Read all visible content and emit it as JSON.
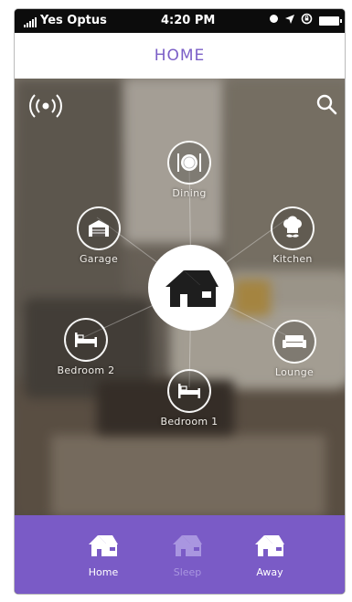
{
  "status_bar": {
    "carrier": "Yes Optus",
    "time": "4:20 PM"
  },
  "header": {
    "title": "HOME"
  },
  "rooms": {
    "dining": "Dining",
    "garage": "Garage",
    "kitchen": "Kitchen",
    "bedroom2": "Bedroom 2",
    "lounge": "Lounge",
    "bedroom1": "Bedroom 1"
  },
  "tabs": [
    {
      "label": "Home",
      "icon": "house-icon",
      "active": true
    },
    {
      "label": "Sleep",
      "icon": "house-icon",
      "active": false
    },
    {
      "label": "Away",
      "icon": "house-icon",
      "active": true
    }
  ],
  "colors": {
    "accent": "#7a5bc6",
    "title": "#7b5fc7",
    "inactive_tab": "#a996e0"
  }
}
